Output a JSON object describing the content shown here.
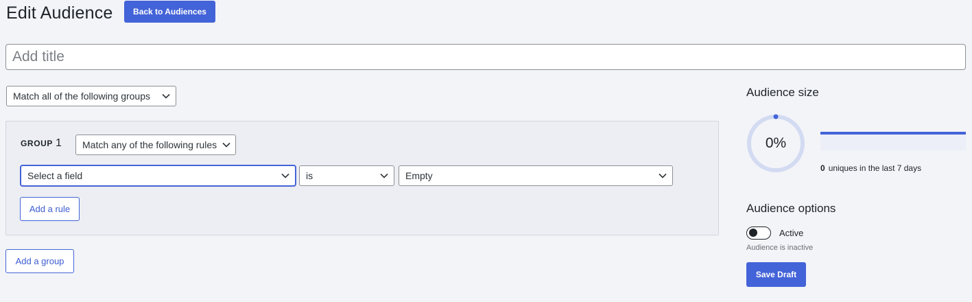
{
  "header": {
    "title": "Edit Audience",
    "back_label": "Back to Audiences"
  },
  "title_field": {
    "value": "",
    "placeholder": "Add title"
  },
  "match_groups": {
    "selected": "Match all of the following groups"
  },
  "group": {
    "label": "GROUP",
    "number": "1",
    "match_rules": "Match any of the following rules",
    "rule": {
      "field": "Select a field",
      "operator": "is",
      "value": "Empty"
    },
    "add_rule_label": "Add a rule"
  },
  "add_group_label": "Add a group",
  "sidebar": {
    "size_heading": "Audience size",
    "percent": "0%",
    "percent_value": 0,
    "uniques_count": "0",
    "uniques_text": "uniques in the last 7 days",
    "options_heading": "Audience options",
    "active_label": "Active",
    "active": false,
    "inactive_note": "Audience is inactive",
    "save_label": "Save Draft"
  },
  "colors": {
    "accent": "#4363d8",
    "ring_track": "#d3dbf2",
    "background": "#f3f4f8"
  },
  "icons": {
    "dropdown": "chevron-down-icon"
  }
}
